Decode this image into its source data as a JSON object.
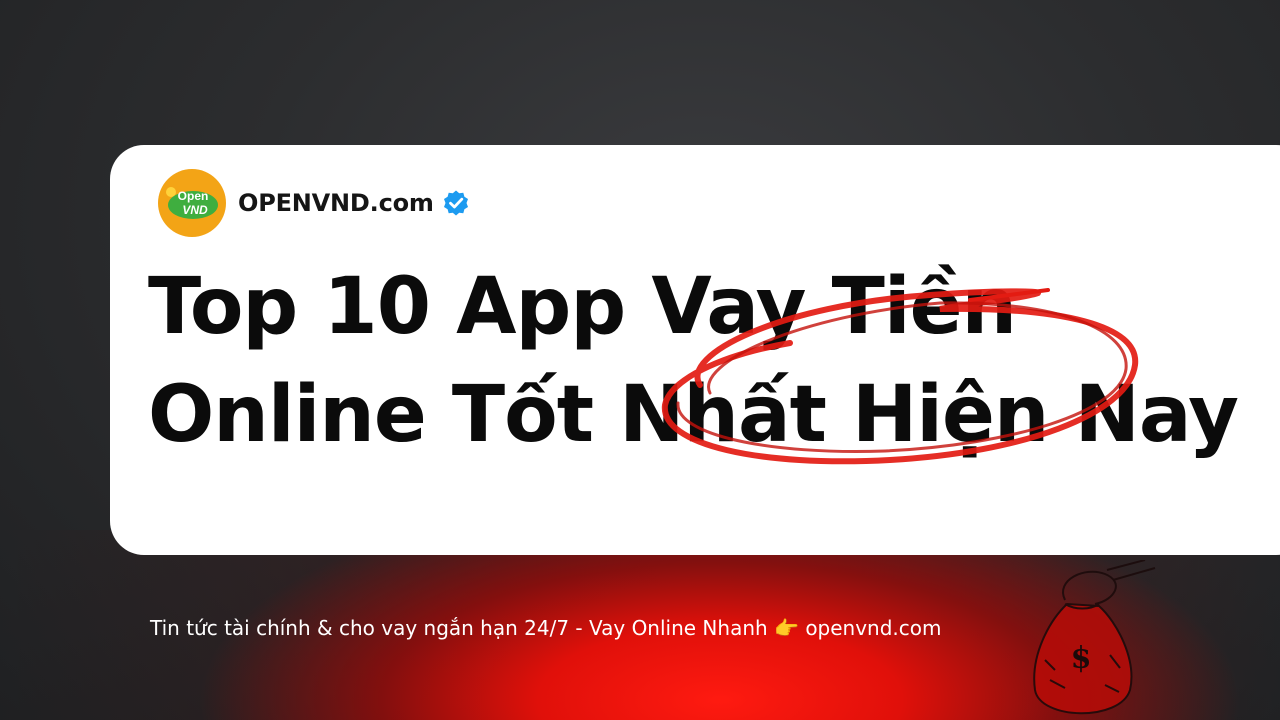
{
  "brand": {
    "logo_text_line1": "Open",
    "logo_text_line2": "VND",
    "name": "OPENVND.com"
  },
  "headline": {
    "line1": "Top 10 App Vay Tiền",
    "line2": "Online Tốt Nhất Hiện Nay"
  },
  "tagline": {
    "text": "Tin tức tài chính & cho vay ngắn hạn 24/7 - Vay Online Nhanh",
    "pointer_emoji": "👉",
    "site": "openvnd.com"
  },
  "money_bag": {
    "symbol": "$"
  },
  "colors": {
    "accent_red": "#e31b12",
    "logo_orange": "#f3a416",
    "logo_green": "#2e9b3a",
    "verified_blue": "#1d9bf0"
  }
}
